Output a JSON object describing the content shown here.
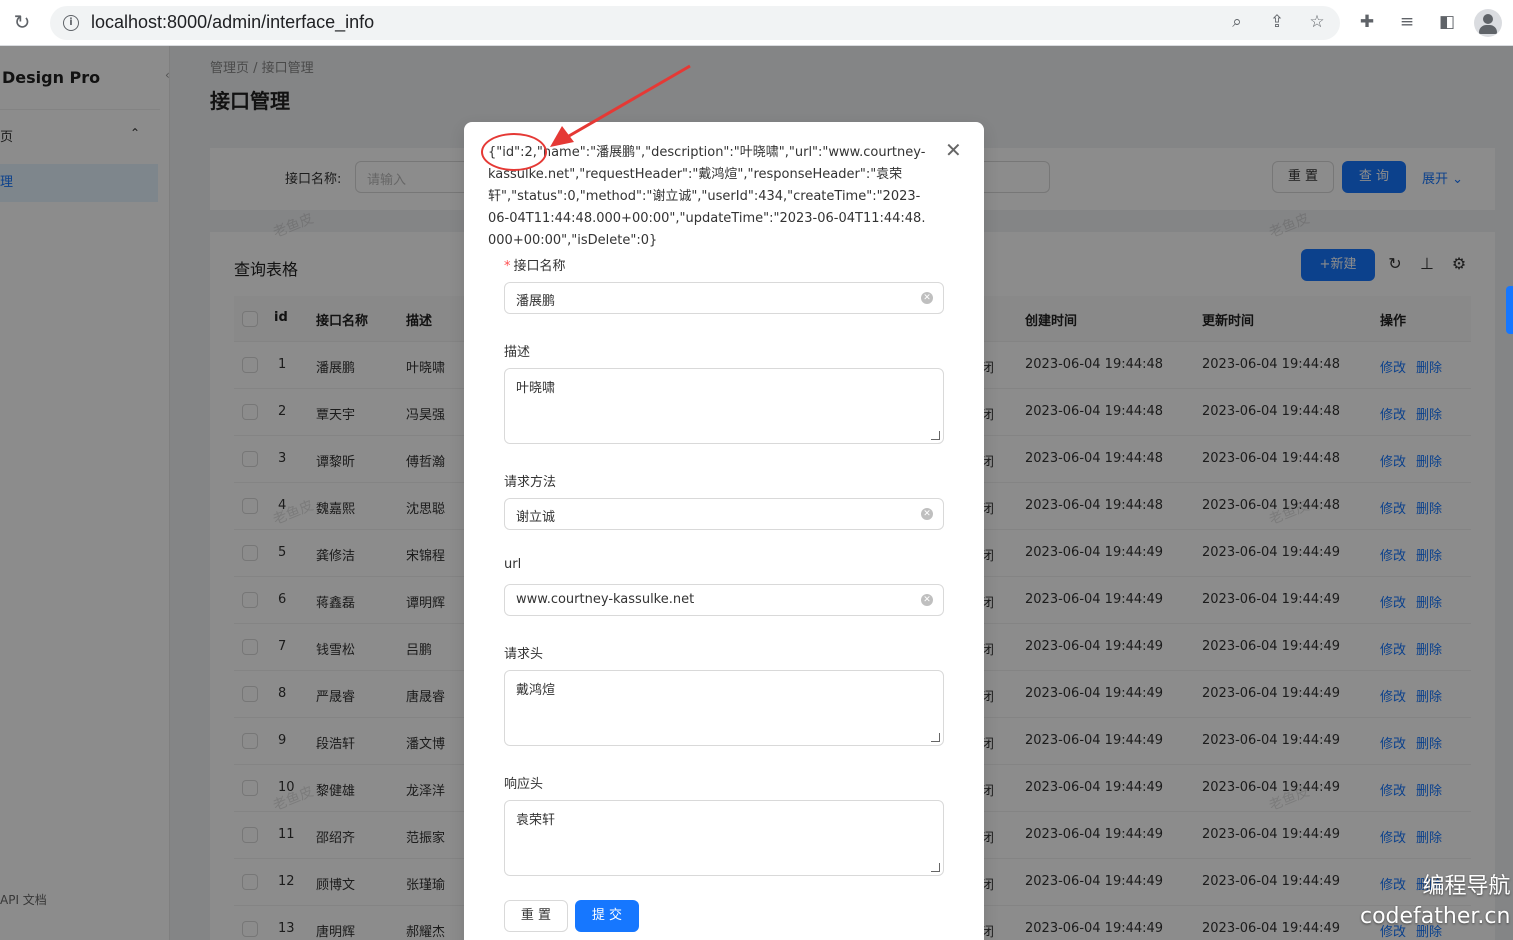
{
  "browser": {
    "url": "localhost:8000/admin/interface_info"
  },
  "sider": {
    "logo": "Design Pro",
    "menu_item_1": "页",
    "menu_item_2": "理",
    "api_doc": "API 文档"
  },
  "breadcrumb": "管理页  /  接口管理",
  "page_title": "接口管理",
  "search": {
    "label": "接口名称:",
    "placeholder": "请输入",
    "reset": "重 置",
    "query": "查 询",
    "expand": "展开"
  },
  "table": {
    "title": "查询表格",
    "new_button": "+新建",
    "headers": {
      "id": "id",
      "name": "接口名称",
      "description": "描述",
      "create_time": "创建时间",
      "update_time": "更新时间",
      "actions": "操作"
    },
    "rows": [
      {
        "id": "1",
        "name": "潘展鹏",
        "desc": "叶晓啸",
        "status": "闭",
        "created": "2023-06-04 19:44:48",
        "updated": "2023-06-04 19:44:48"
      },
      {
        "id": "2",
        "name": "覃天宇",
        "desc": "冯昊强",
        "status": "闭",
        "created": "2023-06-04 19:44:48",
        "updated": "2023-06-04 19:44:48"
      },
      {
        "id": "3",
        "name": "谭黎昕",
        "desc": "傅哲瀚",
        "status": "闭",
        "created": "2023-06-04 19:44:48",
        "updated": "2023-06-04 19:44:48"
      },
      {
        "id": "4",
        "name": "魏嘉熙",
        "desc": "沈思聪",
        "status": "闭",
        "created": "2023-06-04 19:44:48",
        "updated": "2023-06-04 19:44:48"
      },
      {
        "id": "5",
        "name": "龚修洁",
        "desc": "宋锦程",
        "status": "闭",
        "created": "2023-06-04 19:44:49",
        "updated": "2023-06-04 19:44:49"
      },
      {
        "id": "6",
        "name": "蒋鑫磊",
        "desc": "谭明辉",
        "status": "闭",
        "created": "2023-06-04 19:44:49",
        "updated": "2023-06-04 19:44:49"
      },
      {
        "id": "7",
        "name": "钱雪松",
        "desc": "吕鹏",
        "status": "闭",
        "created": "2023-06-04 19:44:49",
        "updated": "2023-06-04 19:44:49"
      },
      {
        "id": "8",
        "name": "严晟睿",
        "desc": "唐晟睿",
        "status": "闭",
        "created": "2023-06-04 19:44:49",
        "updated": "2023-06-04 19:44:49"
      },
      {
        "id": "9",
        "name": "段浩轩",
        "desc": "潘文博",
        "status": "闭",
        "created": "2023-06-04 19:44:49",
        "updated": "2023-06-04 19:44:49"
      },
      {
        "id": "10",
        "name": "黎健雄",
        "desc": "龙泽洋",
        "status": "闭",
        "created": "2023-06-04 19:44:49",
        "updated": "2023-06-04 19:44:49"
      },
      {
        "id": "11",
        "name": "邵绍齐",
        "desc": "范振家",
        "status": "闭",
        "created": "2023-06-04 19:44:49",
        "updated": "2023-06-04 19:44:49"
      },
      {
        "id": "12",
        "name": "顾博文",
        "desc": "张瑾瑜",
        "status": "闭",
        "created": "2023-06-04 19:44:49",
        "updated": "2023-06-04 19:44:49"
      },
      {
        "id": "13",
        "name": "唐明辉",
        "desc": "郝耀杰",
        "status": "闭",
        "created": "2023-06-04 19:44:49",
        "updated": "2023-06-04 19:44:49"
      }
    ],
    "edit_label": "修改",
    "delete_label": "删除"
  },
  "watermark": "老鱼皮",
  "modal": {
    "json_text": "{\"id\":2,\"name\":\"潘展鹏\",\"description\":\"叶晓啸\",\"url\":\"www.courtney-kassulke.net\",\"requestHeader\":\"戴鸿煊\",\"responseHeader\":\"袁荣轩\",\"status\":0,\"method\":\"谢立诚\",\"userId\":434,\"createTime\":\"2023-06-04T11:44:48.000+00:00\",\"updateTime\":\"2023-06-04T11:44:48.000+00:00\",\"isDelete\":0}",
    "fields": {
      "name": {
        "label": "接口名称",
        "value": "潘展鹏"
      },
      "description": {
        "label": "描述",
        "value": "叶晓啸"
      },
      "method": {
        "label": "请求方法",
        "value": "谢立诚"
      },
      "url": {
        "label": "url",
        "value": "www.courtney-kassulke.net"
      },
      "request_header": {
        "label": "请求头",
        "value": "戴鸿煊"
      },
      "response_header": {
        "label": "响应头",
        "value": "袁荣轩"
      }
    },
    "reset": "重 置",
    "submit": "提 交"
  },
  "brand": {
    "line1": "编程导航",
    "line2": "codefather.cn"
  },
  "colors": {
    "primary": "#1677ff",
    "annotation": "#e53935"
  },
  "icons": [
    "reload-icon",
    "info-icon",
    "zoom-icon",
    "share-icon",
    "star-icon",
    "extension-icon",
    "reading-list-icon",
    "side-panel-icon",
    "close-icon",
    "reload-table-icon",
    "density-icon",
    "settings-icon"
  ]
}
